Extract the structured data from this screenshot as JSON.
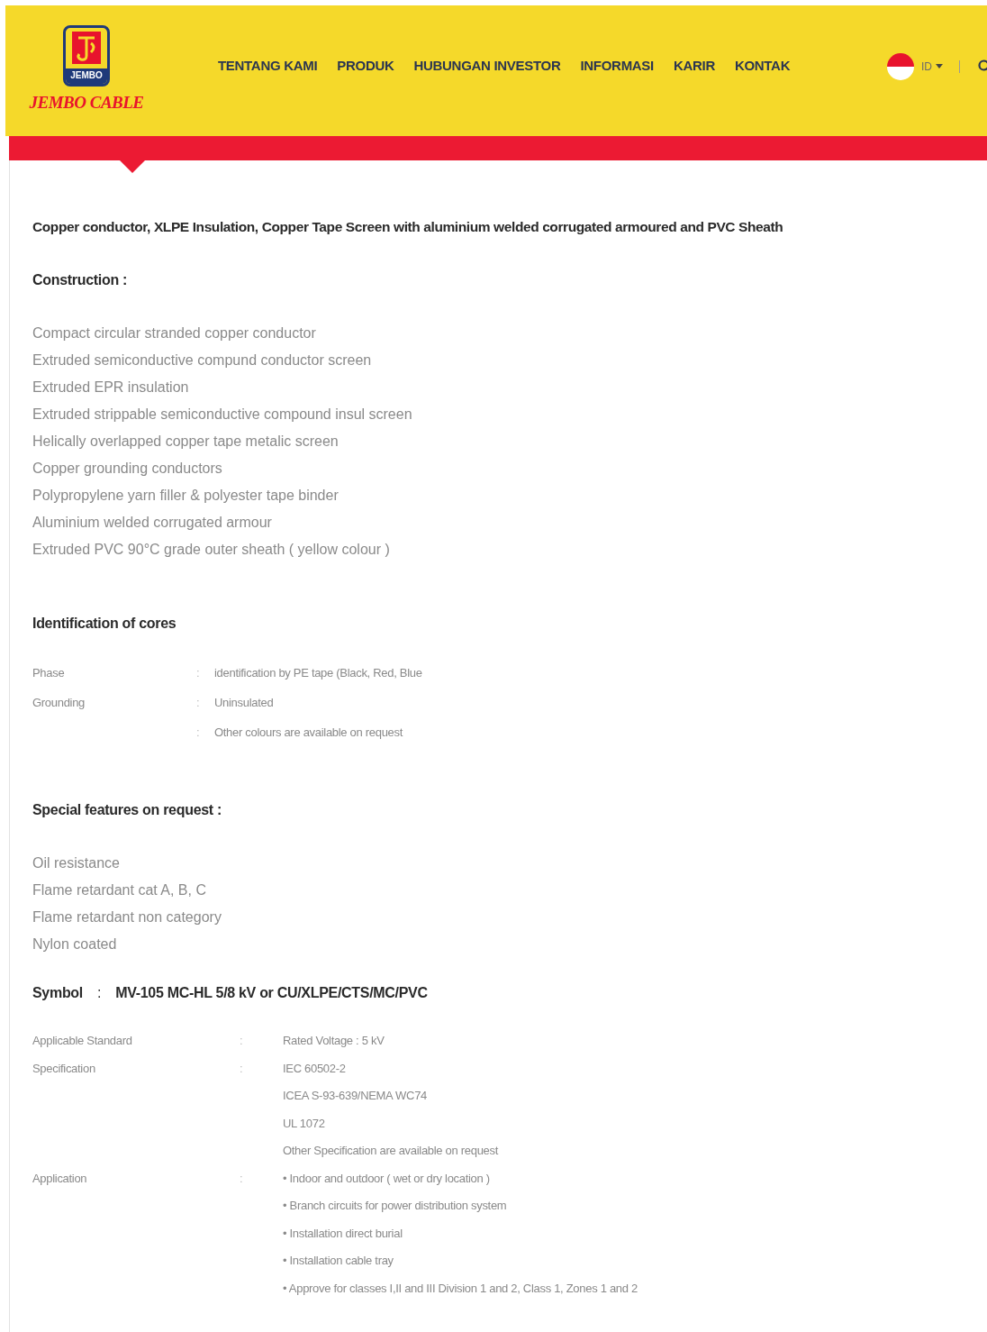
{
  "header": {
    "logo": {
      "badge": "JEMBO",
      "name": "JEMBO CABLE"
    },
    "nav": [
      {
        "label": "TENTANG KAMI"
      },
      {
        "label": "PRODUK"
      },
      {
        "label": "HUBUNGAN INVESTOR"
      },
      {
        "label": "INFORMASI"
      },
      {
        "label": "KARIR"
      },
      {
        "label": "KONTAK"
      }
    ],
    "language": "ID"
  },
  "title": "Copper conductor, XLPE Insulation, Copper Tape Screen with aluminium welded corrugated armoured and PVC Sheath",
  "construction": {
    "heading": "Construction :",
    "items": [
      "Compact circular stranded copper conductor",
      "Extruded semiconductive compund conductor screen",
      "Extruded EPR insulation",
      "Extruded strippable semiconductive compound insul screen",
      "Helically overlapped copper tape metalic screen",
      "Copper grounding conductors",
      "Polypropylene yarn filler & polyester tape binder",
      "Aluminium welded corrugated armour",
      "Extruded PVC 90°C grade outer sheath ( yellow colour )"
    ]
  },
  "identification": {
    "heading": "Identification of cores",
    "rows": [
      {
        "label": "Phase",
        "sep": ":",
        "value": "identification by PE tape (Black, Red, Blue"
      },
      {
        "label": "Grounding",
        "sep": ":",
        "value": "Uninsulated"
      },
      {
        "sep": ":",
        "value": "Other colours are available on request"
      }
    ]
  },
  "special_features": {
    "heading": "Special features on request :",
    "items": [
      "Oil resistance",
      "Flame retardant cat A, B, C",
      "Flame retardant non category",
      "Nylon coated"
    ]
  },
  "symbol": {
    "label": "Symbol",
    "sep": ":",
    "value": "MV-105 MC-HL 5/8 kV or CU/XLPE/CTS/MC/PVC"
  },
  "specs": [
    {
      "label": "Applicable Standard",
      "sep": ":",
      "values": [
        "Rated Voltage : 5 kV"
      ]
    },
    {
      "label": "Specification",
      "sep": ":",
      "values": [
        "IEC 60502-2",
        "ICEA S-93-639/NEMA WC74",
        "UL 1072",
        "Other Specification are available on request"
      ]
    },
    {
      "label": "Application",
      "sep": ":",
      "values": [
        "• Indoor and outdoor ( wet or dry location )",
        "• Branch circuits for power distribution system",
        "• Installation direct burial",
        "• Installation cable tray",
        "• Approve for classes I,II and III Division 1 and 2, Class 1, Zones 1 and 2"
      ]
    }
  ]
}
